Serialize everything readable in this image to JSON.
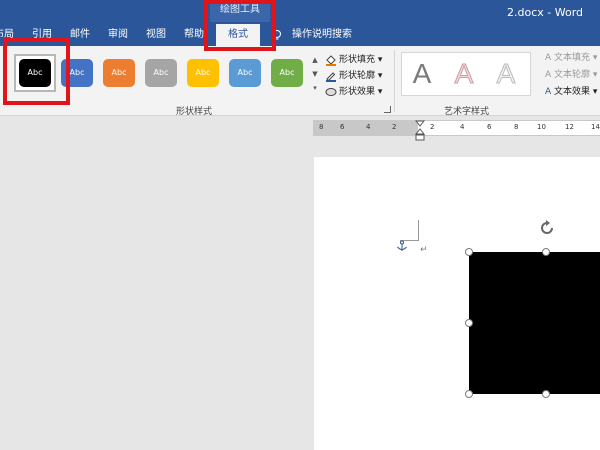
{
  "window": {
    "title": "2.docx  -  Word"
  },
  "contextual_group": {
    "label": "绘图工具"
  },
  "tabs": [
    {
      "label": "布局"
    },
    {
      "label": "引用"
    },
    {
      "label": "邮件"
    },
    {
      "label": "审阅"
    },
    {
      "label": "视图"
    },
    {
      "label": "帮助"
    },
    {
      "label": "格式"
    },
    {
      "label": "操作说明搜索"
    }
  ],
  "shape_styles": {
    "group_label": "形状样式",
    "swatches": [
      {
        "label": "Abc",
        "color": "#000000"
      },
      {
        "label": "Abc",
        "color": "#4472c4"
      },
      {
        "label": "Abc",
        "color": "#ed7d31"
      },
      {
        "label": "Abc",
        "color": "#a5a5a5"
      },
      {
        "label": "Abc",
        "color": "#ffc000"
      },
      {
        "label": "Abc",
        "color": "#5b9bd5"
      },
      {
        "label": "Abc",
        "color": "#70ad47"
      }
    ],
    "commands": [
      {
        "label": "形状填充"
      },
      {
        "label": "形状轮廓"
      },
      {
        "label": "形状效果"
      }
    ]
  },
  "wordart": {
    "group_label": "艺术字样式",
    "samples": [
      {
        "label": "A"
      },
      {
        "label": "A"
      },
      {
        "label": "A"
      }
    ],
    "commands": [
      {
        "label": "文本填充"
      },
      {
        "label": "文本轮廓"
      },
      {
        "label": "文本效果"
      }
    ]
  },
  "ruler": {
    "ticks": [
      "8",
      "6",
      "4",
      "2",
      "2",
      "4",
      "6",
      "8",
      "10",
      "12",
      "14"
    ]
  },
  "colors": {
    "accent": "#2b579a",
    "highlight": "#e0141b"
  }
}
